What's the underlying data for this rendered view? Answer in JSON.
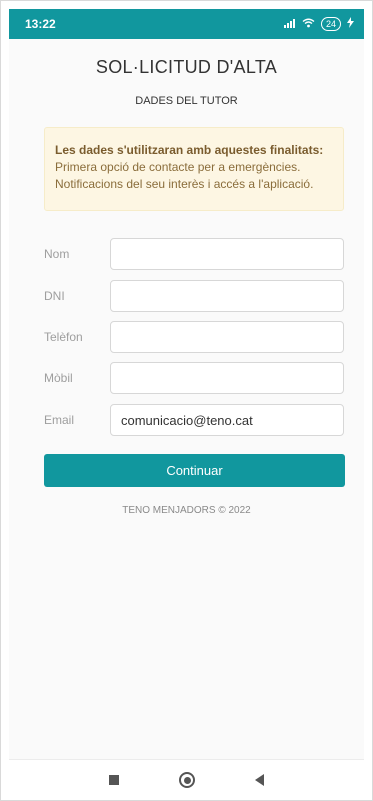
{
  "status_bar": {
    "time": "13:22",
    "battery": "24",
    "icons": [
      "signal-icon",
      "wifi-icon",
      "battery-icon",
      "charging-icon"
    ]
  },
  "header": {
    "title": "SOL·LICITUD D'ALTA",
    "subtitle": "DADES DEL TUTOR"
  },
  "notice": {
    "heading": "Les dades s'utilitzaran amb aquestes finalitats:",
    "line1": "Primera opció de contacte per a emergències.",
    "line2": "Notificacions del seu interès i accés a l'aplicació."
  },
  "form": {
    "fields": [
      {
        "label": "Nom",
        "value": ""
      },
      {
        "label": "DNI",
        "value": ""
      },
      {
        "label": "Telèfon",
        "value": ""
      },
      {
        "label": "Mòbil",
        "value": ""
      },
      {
        "label": "Email",
        "value": "comunicacio@teno.cat"
      }
    ],
    "submit_label": "Continuar"
  },
  "footer": {
    "text": "TENO MENJADORS © 2022"
  },
  "colors": {
    "accent": "#11979e",
    "notice_bg": "#fdf6e3",
    "notice_text": "#8a6d3b"
  }
}
